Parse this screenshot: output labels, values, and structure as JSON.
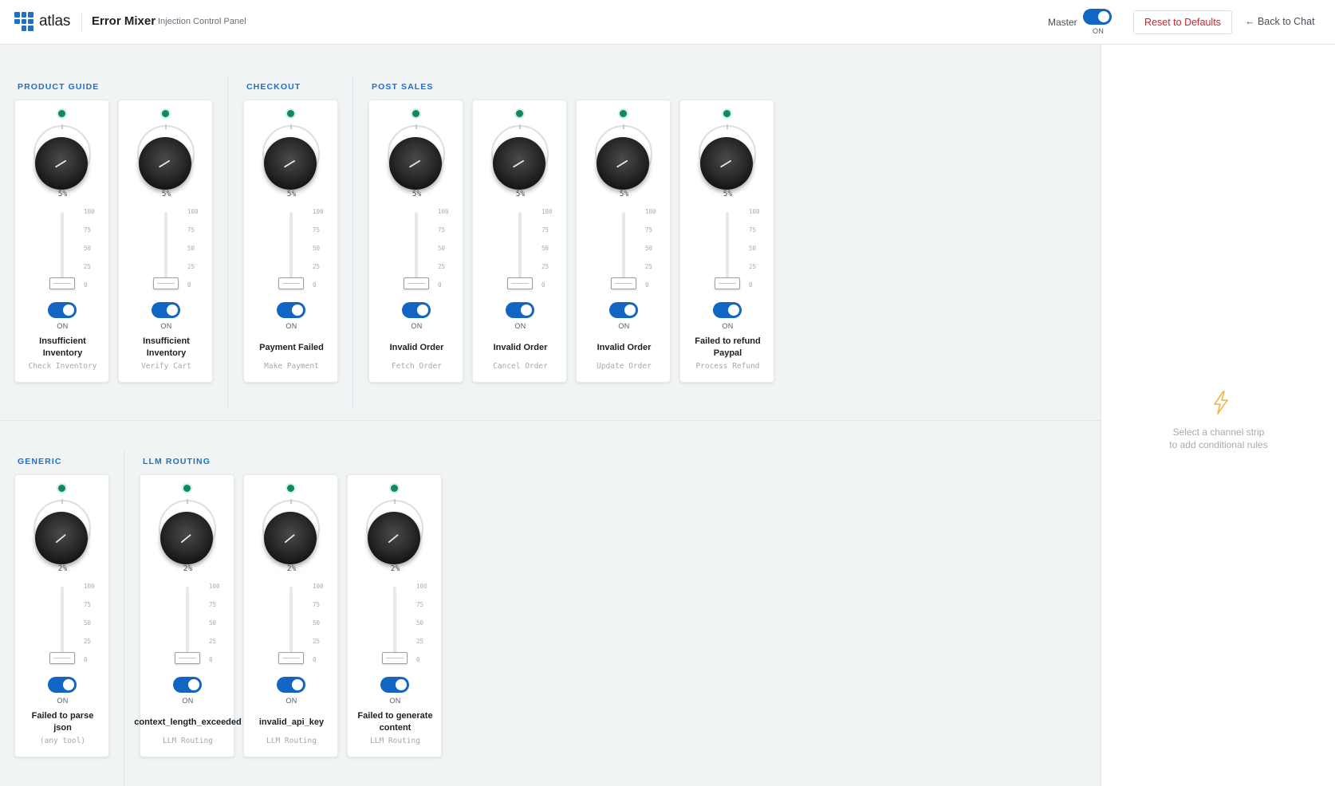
{
  "header": {
    "brand": "atlas",
    "title": "Error Mixer",
    "subtitle": "Injection Control Panel",
    "master_label": "Master",
    "master_state": "ON",
    "reset_label": "Reset to Defaults",
    "back_label": "← Back to Chat"
  },
  "sidebar": {
    "hint_line1": "Select a channel strip",
    "hint_line2": "to add conditional rules"
  },
  "groups": [
    {
      "label": "PRODUCT GUIDE"
    },
    {
      "label": "CHECKOUT"
    },
    {
      "label": "POST SALES"
    },
    {
      "label": "GENERIC"
    },
    {
      "label": "LLM ROUTING"
    }
  ],
  "scale_labels": [
    "100",
    "75",
    "50",
    "25",
    "0"
  ],
  "channels": [
    {
      "group": "PRODUCT GUIDE",
      "error": "Insufficient Inventory",
      "tool": "Check Inventory",
      "percent": "5%",
      "level": 5,
      "enabled": true,
      "state": "ON"
    },
    {
      "group": "PRODUCT GUIDE",
      "error": "Insufficient Inventory",
      "tool": "Verify Cart",
      "percent": "5%",
      "level": 5,
      "enabled": true,
      "state": "ON"
    },
    {
      "group": "CHECKOUT",
      "error": "Payment Failed",
      "tool": "Make Payment",
      "percent": "5%",
      "level": 5,
      "enabled": true,
      "state": "ON"
    },
    {
      "group": "POST SALES",
      "error": "Invalid Order",
      "tool": "Fetch Order",
      "percent": "5%",
      "level": 5,
      "enabled": true,
      "state": "ON"
    },
    {
      "group": "POST SALES",
      "error": "Invalid Order",
      "tool": "Cancel Order",
      "percent": "5%",
      "level": 5,
      "enabled": true,
      "state": "ON"
    },
    {
      "group": "POST SALES",
      "error": "Invalid Order",
      "tool": "Update Order",
      "percent": "5%",
      "level": 5,
      "enabled": true,
      "state": "ON"
    },
    {
      "group": "POST SALES",
      "error": "Failed to refund Paypal",
      "tool": "Process Refund",
      "percent": "5%",
      "level": 5,
      "enabled": true,
      "state": "ON"
    },
    {
      "group": "GENERIC",
      "error": "Failed to parse json",
      "tool": "(any tool)",
      "percent": "2%",
      "level": 2,
      "enabled": true,
      "state": "ON"
    },
    {
      "group": "LLM ROUTING",
      "error": "context_length_exceeded",
      "tool": "LLM Routing",
      "percent": "2%",
      "level": 2,
      "enabled": true,
      "state": "ON"
    },
    {
      "group": "LLM ROUTING",
      "error": "invalid_api_key",
      "tool": "LLM Routing",
      "percent": "2%",
      "level": 2,
      "enabled": true,
      "state": "ON"
    },
    {
      "group": "LLM ROUTING",
      "error": "Failed to generate content",
      "tool": "LLM Routing",
      "percent": "2%",
      "level": 2,
      "enabled": true,
      "state": "ON"
    }
  ],
  "colors": {
    "accent": "#1365c4",
    "group_label": "#1f6fc5",
    "led_active": "#0f8a5f",
    "reset_text": "#c4252f",
    "bolt": "#f0b44c"
  },
  "icons": [
    "atlas-logo-icon",
    "lightning-bolt-icon",
    "led-indicator-icon",
    "knob-icon"
  ]
}
